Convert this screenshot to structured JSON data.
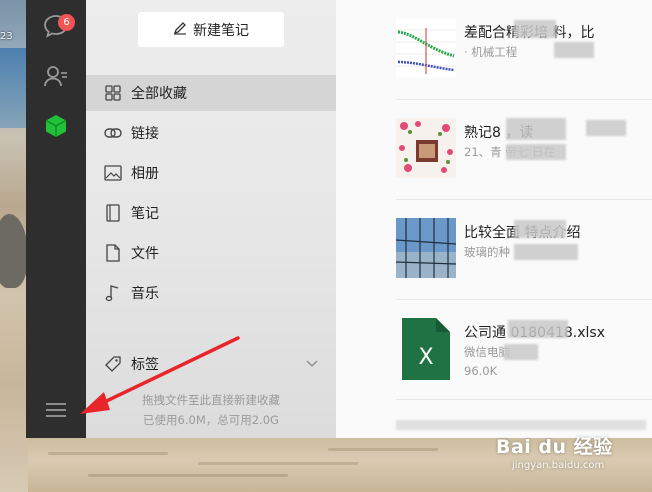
{
  "desktop": {
    "clock_fragment": "23"
  },
  "nav": {
    "unread_badge": "6",
    "items": [
      {
        "name": "chat-icon"
      },
      {
        "name": "contacts-icon"
      },
      {
        "name": "favorites-cube-icon"
      },
      {
        "name": "menu-icon"
      }
    ],
    "accent_green": "#22c13a",
    "badge_red": "#f25454"
  },
  "sidebar": {
    "new_note_label": "新建笔记",
    "categories": [
      {
        "label": "全部收藏",
        "icon": "grid-icon"
      },
      {
        "label": "链接",
        "icon": "link-icon"
      },
      {
        "label": "相册",
        "icon": "image-icon"
      },
      {
        "label": "笔记",
        "icon": "note-icon"
      },
      {
        "label": "文件",
        "icon": "file-icon"
      },
      {
        "label": "音乐",
        "icon": "music-icon"
      }
    ],
    "selected_index": 0,
    "tags_label": "标签",
    "drop_hint": "拖拽文件至此直接新建收藏",
    "storage_info": "已使用6.0M，总可用2.0G"
  },
  "list": {
    "items": [
      {
        "title": "差配合精彩培   料，比",
        "subtitle": "· 机械工程   ",
        "thumb": "chart"
      },
      {
        "title": "熟记8   ，读   ",
        "subtitle": "21、青   帝七   日在",
        "thumb": "flower"
      },
      {
        "title": "比较全面   特点介绍",
        "subtitle": "玻璃的种",
        "thumb": "building"
      },
      {
        "title": "公司通   0180418.xlsx",
        "subtitle": "微信电脑",
        "size": "96.0K",
        "thumb": "excel"
      }
    ],
    "excel_green": "#1f7244"
  },
  "watermark": {
    "brand": "Bai du 经验",
    "url": "jingyan.baidu.com"
  }
}
